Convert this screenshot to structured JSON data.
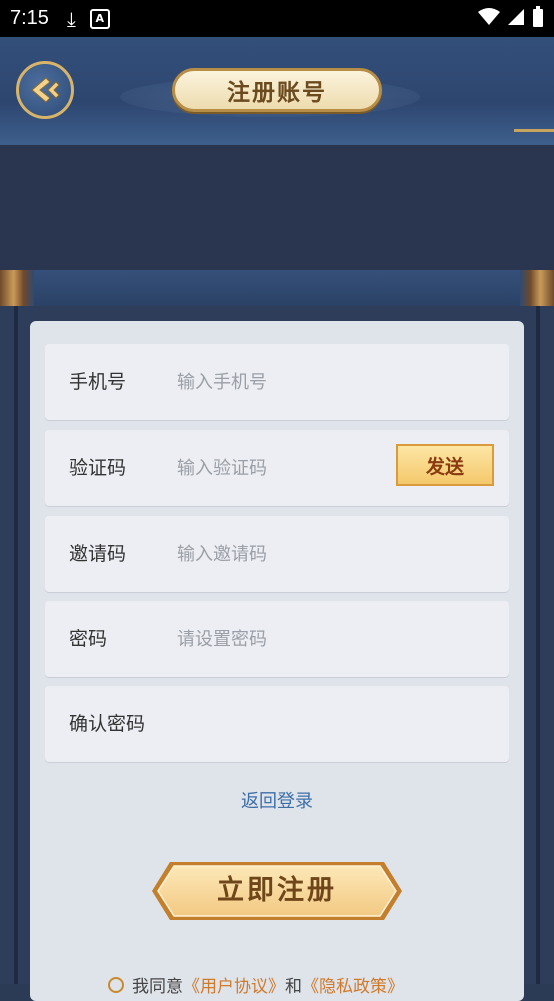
{
  "status_bar": {
    "time": "7:15"
  },
  "header": {
    "title": "注册账号"
  },
  "form": {
    "phone": {
      "label": "手机号",
      "placeholder": "输入手机号"
    },
    "code": {
      "label": "验证码",
      "placeholder": "输入验证码",
      "send_label": "发送"
    },
    "invite": {
      "label": "邀请码",
      "placeholder": "输入邀请码"
    },
    "password": {
      "label": "密码",
      "placeholder": "请设置密码"
    },
    "confirm": {
      "label": "确认密码",
      "placeholder": ""
    }
  },
  "back_login": "返回登录",
  "register_label": "立即注册",
  "agreement": {
    "prefix": "我同意",
    "user_agreement": "《用户协议》",
    "and": "和",
    "privacy_policy": "《隐私政策》"
  },
  "colors": {
    "accent_gold": "#c7a45e",
    "link_blue": "#3c6fa8",
    "link_orange": "#d07a2a"
  }
}
